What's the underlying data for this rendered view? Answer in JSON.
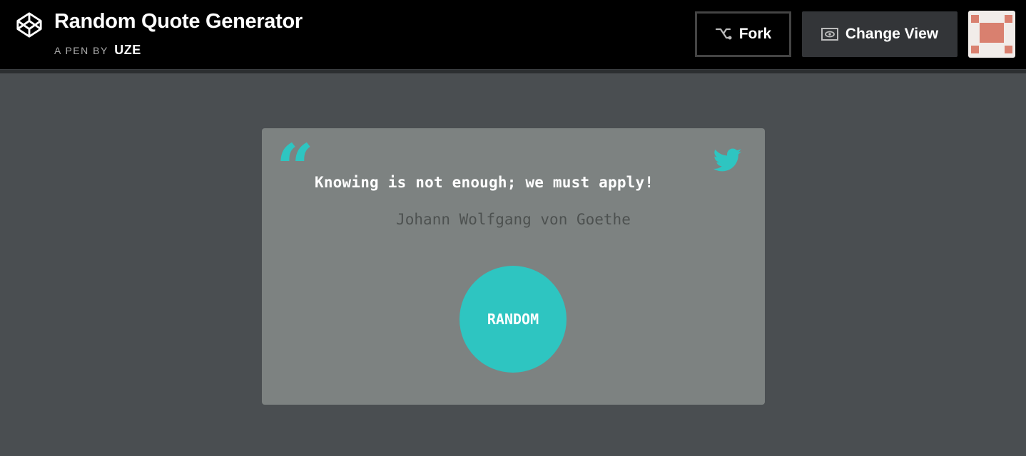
{
  "header": {
    "title": "Random Quote Generator",
    "byline_prefix": "A PEN BY",
    "author": "UZE",
    "fork_label": "Fork",
    "change_view_label": "Change View"
  },
  "quote": {
    "text": "Knowing is not enough; we must apply!",
    "author": "Johann Wolfgang von Goethe",
    "mark": "“",
    "random_label": "RANDOM"
  },
  "colors": {
    "accent": "#2ec5c1",
    "page_background": "#4a4e51",
    "card_background": "#7d8281",
    "avatar": "#d9806f"
  },
  "icons": {
    "logo": "codepen-logo-icon",
    "fork": "fork-icon",
    "view": "eye-icon",
    "share": "twitter-icon"
  }
}
